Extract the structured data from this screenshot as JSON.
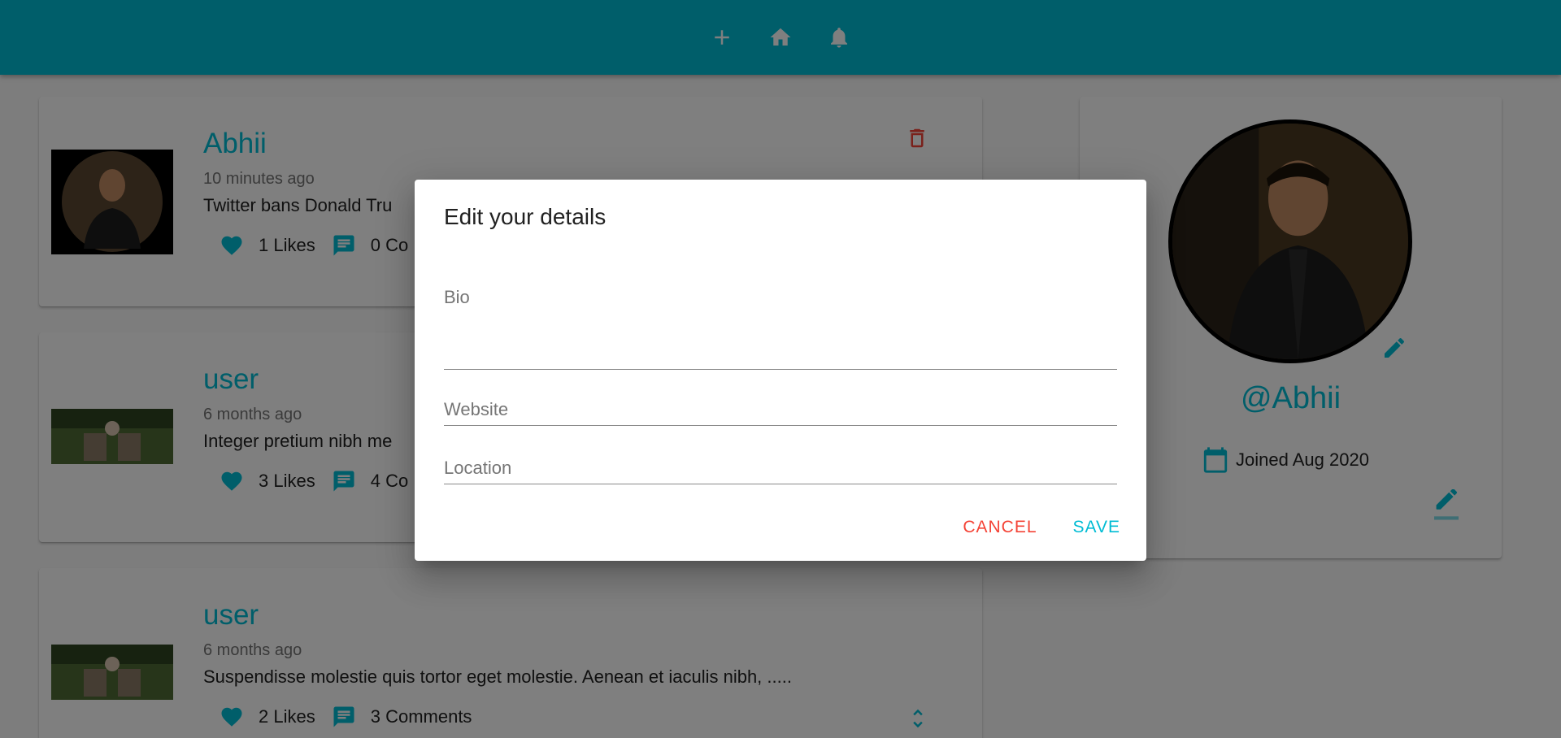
{
  "navbar": {
    "icons": [
      "add-icon",
      "home-icon",
      "notifications-icon"
    ],
    "color": "#00bcd4"
  },
  "posts": [
    {
      "author": "Abhii",
      "time": "10 minutes ago",
      "body": "Twitter bans Donald Tru",
      "likes": "1 Likes",
      "comments": "0 Co"
    },
    {
      "author": "user",
      "time": "6 months ago",
      "body": "Integer pretium nibh me",
      "likes": "3 Likes",
      "comments": "4 Co"
    },
    {
      "author": "user",
      "time": "6 months ago",
      "body": "Suspendisse molestie quis tortor eget molestie. Aenean et iaculis nibh, .....",
      "likes": "2 Likes",
      "comments": "3 Comments"
    }
  ],
  "profile": {
    "handle": "@Abhii",
    "joined": "Joined Aug 2020"
  },
  "dialog": {
    "title": "Edit your details",
    "bio_label": "Bio",
    "website_placeholder": "Website",
    "location_placeholder": "Location",
    "cancel_label": "CANCEL",
    "save_label": "SAVE"
  },
  "colors": {
    "primary": "#00bcd4",
    "danger": "#f44336"
  }
}
